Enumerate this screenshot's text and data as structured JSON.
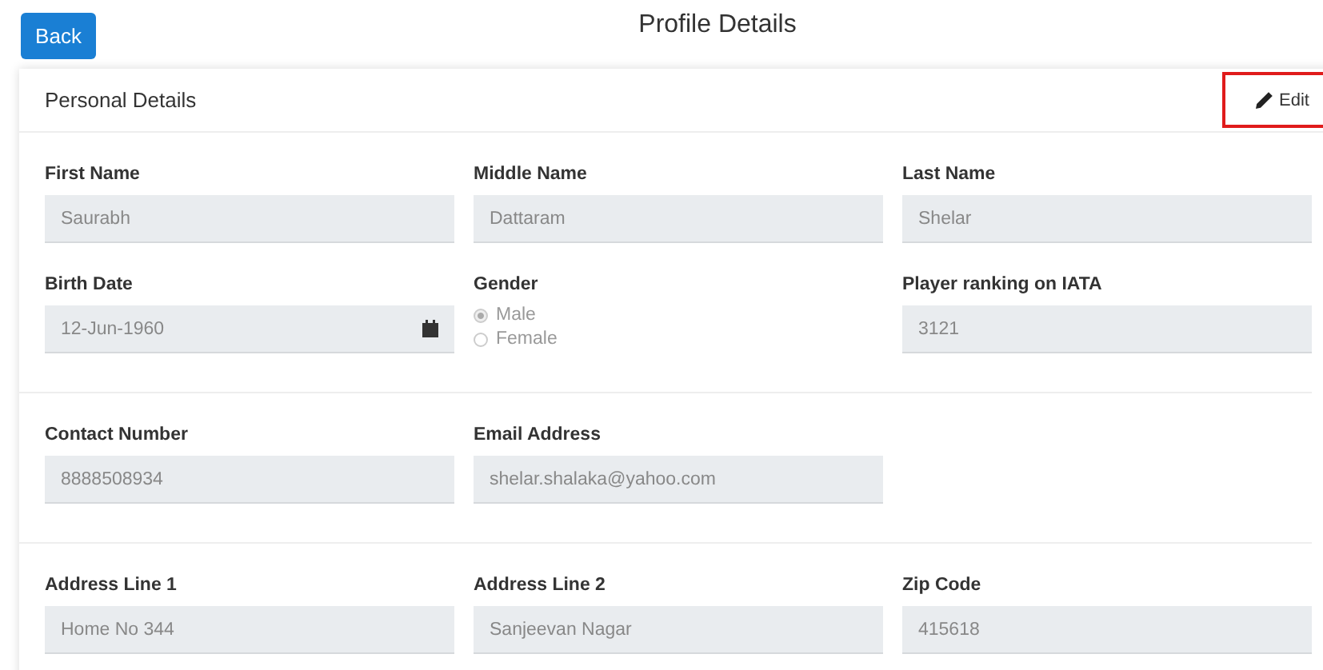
{
  "header": {
    "back_button": "Back",
    "title": "Profile Details"
  },
  "card": {
    "title": "Personal Details",
    "edit_button": {
      "label": "Edit",
      "highlighted": true
    }
  },
  "sections": [
    {
      "fields": [
        {
          "kind": "text",
          "label": "First Name",
          "value": "Saurabh"
        },
        {
          "kind": "text",
          "label": "Middle Name",
          "value": "Dattaram"
        },
        {
          "kind": "text",
          "label": "Last Name",
          "value": "Shelar"
        },
        {
          "kind": "date",
          "label": "Birth Date",
          "value": "12-Jun-1960"
        },
        {
          "kind": "radio",
          "label": "Gender",
          "options": [
            {
              "label": "Male",
              "selected": true
            },
            {
              "label": "Female",
              "selected": false
            }
          ]
        },
        {
          "kind": "text",
          "label": "Player ranking on IATA",
          "value": "3121"
        }
      ]
    },
    {
      "fields": [
        {
          "kind": "text",
          "label": "Contact Number",
          "value": "8888508934"
        },
        {
          "kind": "text",
          "label": "Email Address",
          "value": "shelar.shalaka@yahoo.com"
        }
      ]
    },
    {
      "fields": [
        {
          "kind": "text",
          "label": "Address Line 1",
          "value": "Home No 344"
        },
        {
          "kind": "text",
          "label": "Address Line 2",
          "value": "Sanjeevan Nagar"
        },
        {
          "kind": "text",
          "label": "Zip Code",
          "value": "415618"
        }
      ]
    }
  ]
}
